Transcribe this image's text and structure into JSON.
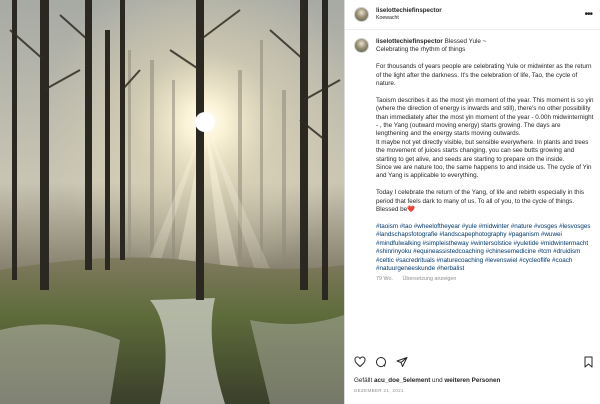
{
  "post": {
    "username": "liselottechiefinspector",
    "location": "Koewacht",
    "caption_title": "Blessed Yule ~",
    "caption_subtitle": "Celebrating the rhythm of things",
    "paragraphs": [
      "For thousands of years people are celebrating Yule or midwinter as the return of the light after the darkness. It's the celebration of life, Tao, the cycle of nature.",
      "Taoism describes it as the most yin moment of the year. This moment is so yin (where the direction of energy is inwards and still), there's no other possibility than immediately after the most yin moment of the year - 0.00h midwinternight - , the Yang (outward moving energy) starts growing. The days are lengthening and the energy starts moving outwards.",
      "It maybe not yet directly visible, but sensible everywhere. In plants and trees the movement of juices starts changing, you can see butts growing and starting to get alive, and seeds are starting to prepare on the inside.",
      "Since we are nature too, the same happens to and inside us. The cycle of Yin and Yang is applicable to everything.",
      "Today I celebrate the return of the Yang, of life and rebirth especially in this period that feels dark to many of us. To all of you, to the cycle of things. Blessed be"
    ],
    "heart_emoji": "❤️",
    "hashtags": "#taoism #tao #wheeloftheyear #yule #midwinter #nature #vosges #lesvosges #landschapsfotografie #landscapephotography #paganism #wuwei #mindfulwalking #simpleistheway #wintersolstice #yuletide #midwintermacht #shinrinyoku #equineassistedcoaching #chinesemedicine #tcm #druidism #celtic #sacredrituals #naturecoaching #levenswiel #cycleoflife #coach #natuurgeneeskunde #herbalist",
    "time_ago": "79 Wo.",
    "translate_label": "Übersetzung anzeigen",
    "liked_prefix": "Gefällt ",
    "liked_user": "acu_doe_5element",
    "liked_mid": " und ",
    "liked_others": "weiteren Personen",
    "date": "DEZEMBER 21, 2021"
  },
  "icons": {
    "more": "more-options-icon",
    "like": "heart-icon",
    "comment": "comment-icon",
    "share": "share-icon",
    "save": "bookmark-icon"
  },
  "colors": {
    "link": "#00376b",
    "muted": "#8e8e8e",
    "heart": "#e0245e",
    "border": "#dbdbdb"
  }
}
